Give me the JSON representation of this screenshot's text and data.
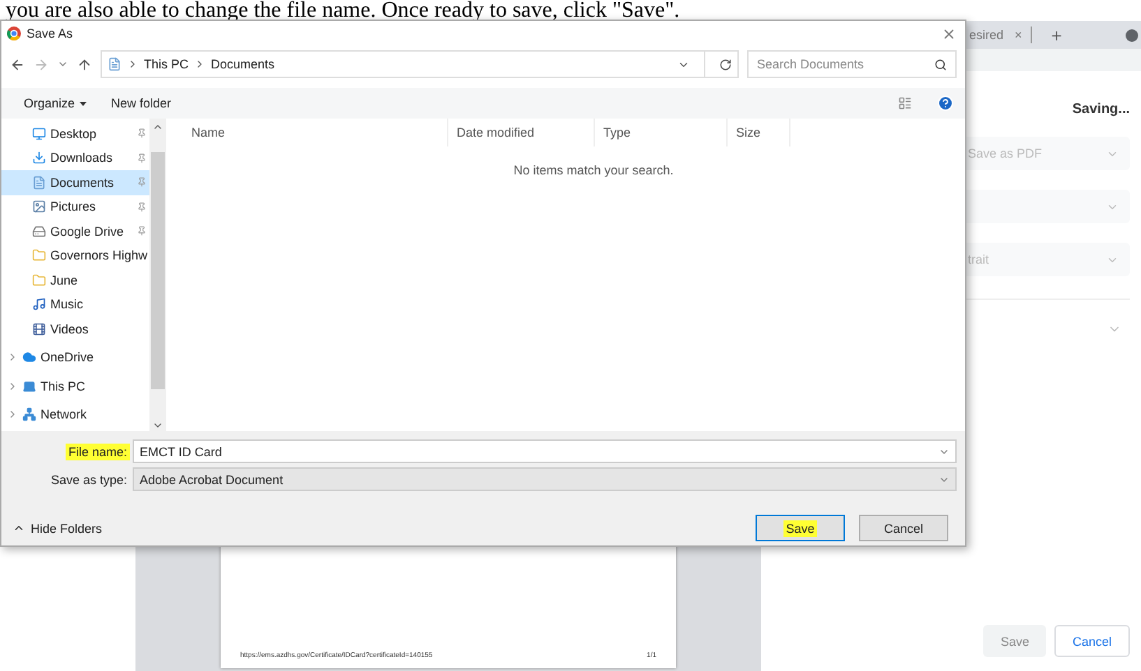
{
  "instruction_text": "you are also able to change the file name. Once ready to save, click \"Save\".",
  "browser": {
    "tab": {
      "label": "esired",
      "close": "×"
    },
    "new_tab": "+"
  },
  "print_panel": {
    "status": "Saving...",
    "disabled": true,
    "selects": [
      {
        "kind": "dropdown",
        "value": "Save as PDF"
      },
      {
        "kind": "dropdown"
      },
      {
        "kind": "dropdown",
        "value": "trait"
      }
    ],
    "buttons": [
      {
        "label": "Save",
        "kind": "secondary"
      },
      {
        "label": "Cancel",
        "kind": "primary"
      }
    ]
  },
  "preview": {
    "footer_url": "https://ems.azdhs.gov/Certificate/IDCard?certificateId=140155",
    "page_count": "1/1"
  },
  "dialog": {
    "title": "Save As",
    "path": [
      "This PC",
      "Documents"
    ],
    "search_placeholder": "Search Documents",
    "toolbar": [
      "Organize",
      "New folder"
    ],
    "nav_items": [
      {
        "label": "Desktop",
        "kind": "quick",
        "pinned": true,
        "selected": false
      },
      {
        "label": "Downloads",
        "kind": "quick",
        "pinned": true,
        "selected": false
      },
      {
        "label": "Documents",
        "kind": "quick",
        "pinned": true,
        "selected": true
      },
      {
        "label": "Pictures",
        "kind": "quick",
        "pinned": true,
        "selected": false
      },
      {
        "label": "Google Drive",
        "kind": "quick",
        "pinned": true,
        "selected": false
      },
      {
        "label": "Governors Highw",
        "kind": "quick",
        "pinned": false,
        "selected": false
      },
      {
        "label": "June",
        "kind": "quick",
        "pinned": false,
        "selected": false
      },
      {
        "label": "Music",
        "kind": "quick",
        "pinned": false,
        "selected": false
      },
      {
        "label": "Videos",
        "kind": "quick",
        "pinned": false,
        "selected": false
      },
      {
        "label": "OneDrive",
        "kind": "root",
        "pinned": false,
        "selected": false
      },
      {
        "label": "This PC",
        "kind": "root",
        "pinned": false,
        "selected": false
      },
      {
        "label": "Network",
        "kind": "root",
        "pinned": false,
        "selected": false
      }
    ],
    "columns": [
      "Name",
      "Date modified",
      "Type",
      "Size"
    ],
    "empty_message": "No items match your search.",
    "file_name": {
      "label": "File name:",
      "value": "EMCT ID Card",
      "highlighted": true
    },
    "save_type": {
      "label": "Save as type:",
      "value": "Adobe Acrobat Document",
      "highlighted": false
    },
    "hide_folders": "Hide Folders",
    "buttons": [
      {
        "label": "Save",
        "kind": "default",
        "highlighted": true
      },
      {
        "label": "Cancel",
        "kind": "normal",
        "highlighted": false
      }
    ]
  }
}
